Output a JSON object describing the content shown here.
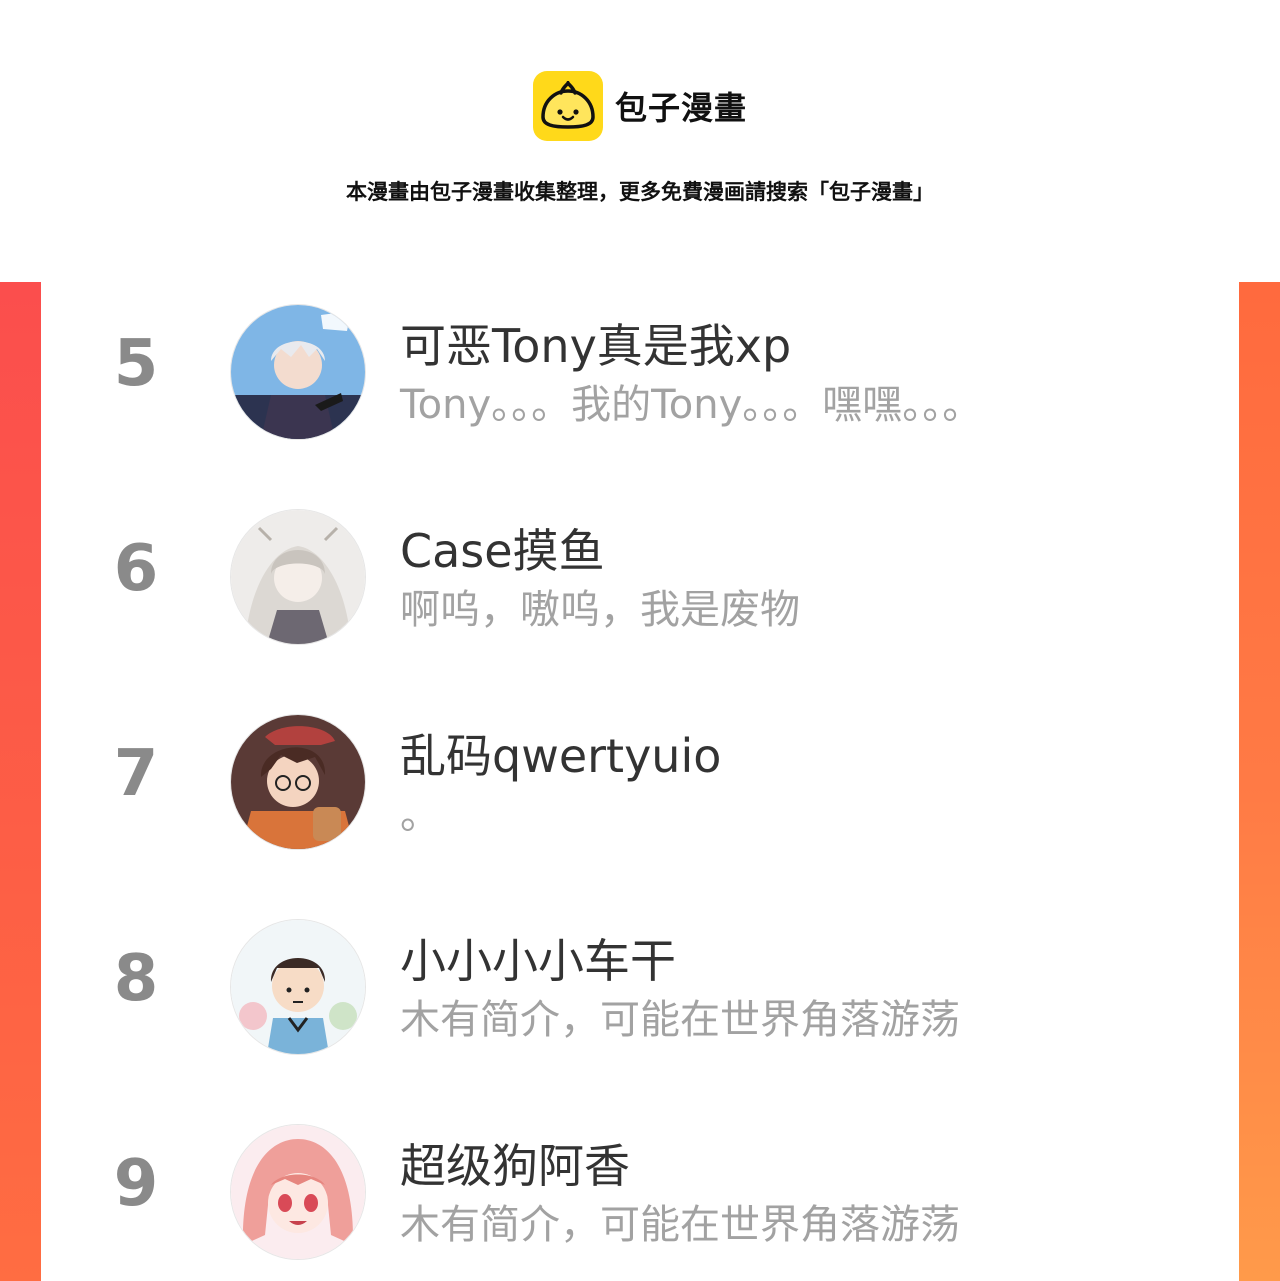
{
  "brand": {
    "name": "包子漫畫"
  },
  "notice": "本漫畫由包子漫畫收集整理，更多免費漫画請搜索「包子漫畫」",
  "users": [
    {
      "rank": "5",
      "name": "可恶Tony真是我xp",
      "bio": "Tony。。。我的Tony。。。嘿嘿。。。"
    },
    {
      "rank": "6",
      "name": "Case摸鱼",
      "bio": "啊呜，嗷呜，我是废物"
    },
    {
      "rank": "7",
      "name": "乱码qwertyuio",
      "bio": "。"
    },
    {
      "rank": "8",
      "name": "小小小小车干",
      "bio": "木有简介，可能在世界角落游荡"
    },
    {
      "rank": "9",
      "name": "超级狗阿香",
      "bio": "木有简介，可能在世界角落游荡"
    }
  ],
  "colors": {
    "logo": "#ffd91a",
    "band_left": "#fb4e4d",
    "band_right": "#ff7a45",
    "rank": "#8a8a8a"
  }
}
